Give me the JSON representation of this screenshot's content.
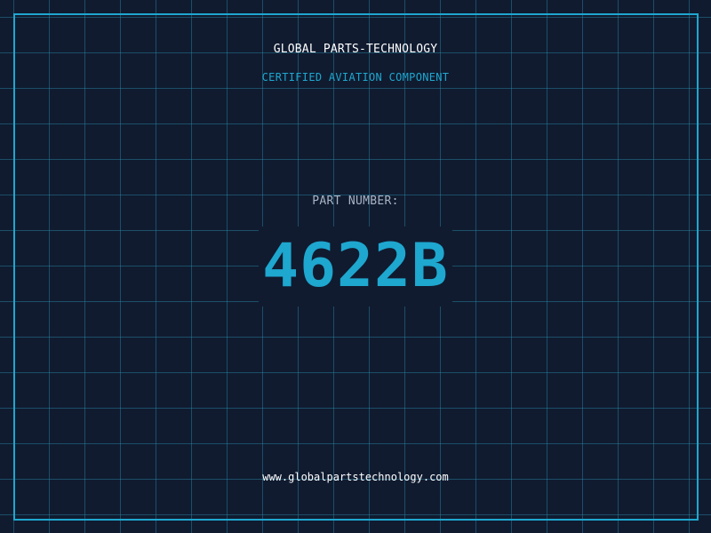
{
  "header": {
    "company": "GLOBAL PARTS-TECHNOLOGY",
    "subtitle": "CERTIFIED AVIATION COMPONENT"
  },
  "part": {
    "label": "PART NUMBER:",
    "number": "4622B"
  },
  "footer": {
    "website": "www.globalpartstechnology.com"
  },
  "colors": {
    "background": "#101b30",
    "accent": "#1ea7cf",
    "grid": "#288caa",
    "text": "#ffffff",
    "muted": "#a8b4c4"
  }
}
